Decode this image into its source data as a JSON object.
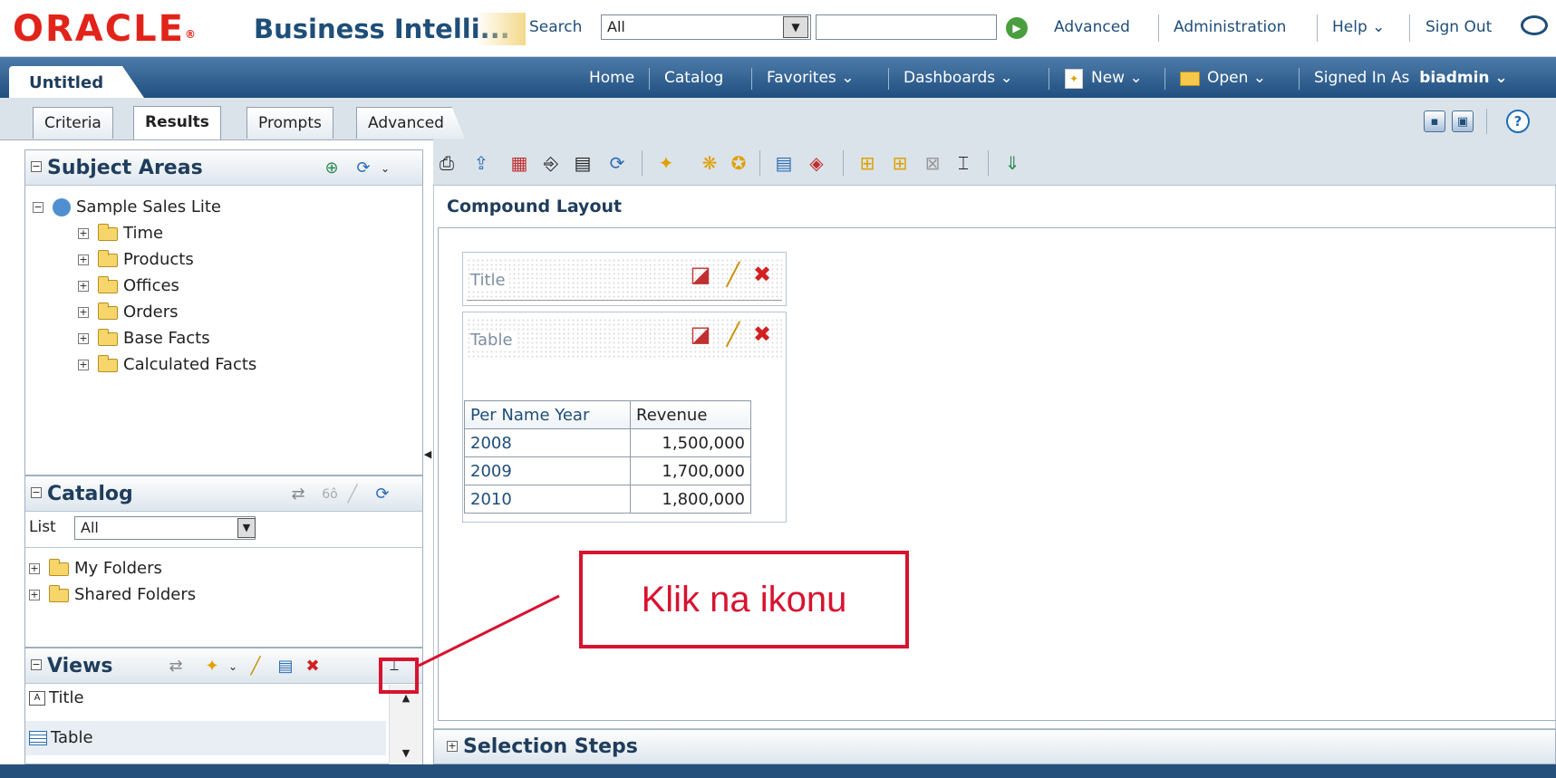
{
  "header": {
    "logo": "ORACLE",
    "app_title": "Business Intelli...",
    "search_label": "Search",
    "search_scope": "All",
    "search_value": "",
    "links": {
      "advanced": "Advanced",
      "administration": "Administration",
      "help": "Help ⌄",
      "sign_out": "Sign Out"
    }
  },
  "titlebar": {
    "document_tab": "Untitled",
    "nav": {
      "home": "Home",
      "catalog": "Catalog",
      "favorites": "Favorites ⌄",
      "dashboards": "Dashboards ⌄",
      "new": "New ⌄",
      "open": "Open ⌄",
      "signed_in_prefix": "Signed In As",
      "user": "biadmin ⌄"
    }
  },
  "tabs": [
    {
      "label": "Criteria"
    },
    {
      "label": "Results"
    },
    {
      "label": "Prompts"
    },
    {
      "label": "Advanced"
    }
  ],
  "active_tab": "Results",
  "subject_areas": {
    "title": "Subject Areas",
    "root": "Sample Sales Lite",
    "folders": [
      "Time",
      "Products",
      "Offices",
      "Orders",
      "Base Facts",
      "Calculated Facts"
    ]
  },
  "catalog": {
    "title": "Catalog",
    "list_label": "List",
    "list_value": "All",
    "folders": [
      "My Folders",
      "Shared Folders"
    ]
  },
  "views_panel": {
    "title": "Views",
    "items": [
      "Title",
      "Table"
    ]
  },
  "content": {
    "heading": "Compound Layout",
    "views": [
      {
        "label": "Title"
      },
      {
        "label": "Table"
      }
    ],
    "table": {
      "headers": [
        "Per Name Year",
        "Revenue"
      ],
      "rows": [
        [
          "2008",
          "1,500,000"
        ],
        [
          "2009",
          "1,700,000"
        ],
        [
          "2010",
          "1,800,000"
        ]
      ]
    }
  },
  "selection_steps": {
    "title": "Selection Steps"
  },
  "annotation": {
    "text": "Klik na ikonu"
  },
  "colors": {
    "oracle_red": "#e2231a",
    "header_blue": "#1f4f80",
    "annotation_red": "#d7132f"
  }
}
